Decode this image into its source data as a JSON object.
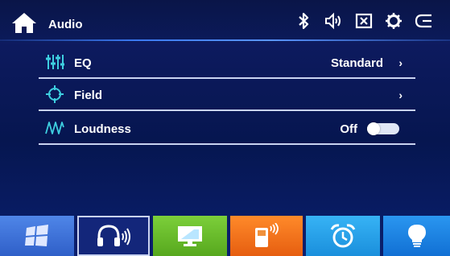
{
  "header": {
    "title": "Audio",
    "icons": [
      "home-icon",
      "bluetooth-icon",
      "volume-icon",
      "close-box-icon",
      "settings-icon",
      "back-icon"
    ]
  },
  "rows": [
    {
      "icon": "equalizer-icon",
      "label": "EQ",
      "value": "Standard",
      "chevron": "›"
    },
    {
      "icon": "crosshair-icon",
      "label": "Field",
      "value": "",
      "chevron": "›"
    },
    {
      "icon": "wave-icon",
      "label": "Loudness",
      "value": "Off",
      "toggle": false
    }
  ],
  "dock": [
    {
      "name": "apps-tile",
      "icon": "windows-icon",
      "color": "#3b6fd6",
      "selected": false
    },
    {
      "name": "audio-tile",
      "icon": "headphones-icon",
      "color": "#1a2f8a",
      "selected": true
    },
    {
      "name": "display-tile",
      "icon": "monitor-icon",
      "color": "#6ab72c",
      "selected": false
    },
    {
      "name": "phone-tile",
      "icon": "phone-icon",
      "color": "#ee6a1a",
      "selected": false
    },
    {
      "name": "alarm-tile",
      "icon": "alarm-clock-icon",
      "color": "#1e9ae8",
      "selected": false
    },
    {
      "name": "light-tile",
      "icon": "bulb-icon",
      "color": "#1a7ee2",
      "selected": false
    }
  ],
  "colors": {
    "accent": "#3a78f0",
    "divider": "#c9d3f0"
  }
}
